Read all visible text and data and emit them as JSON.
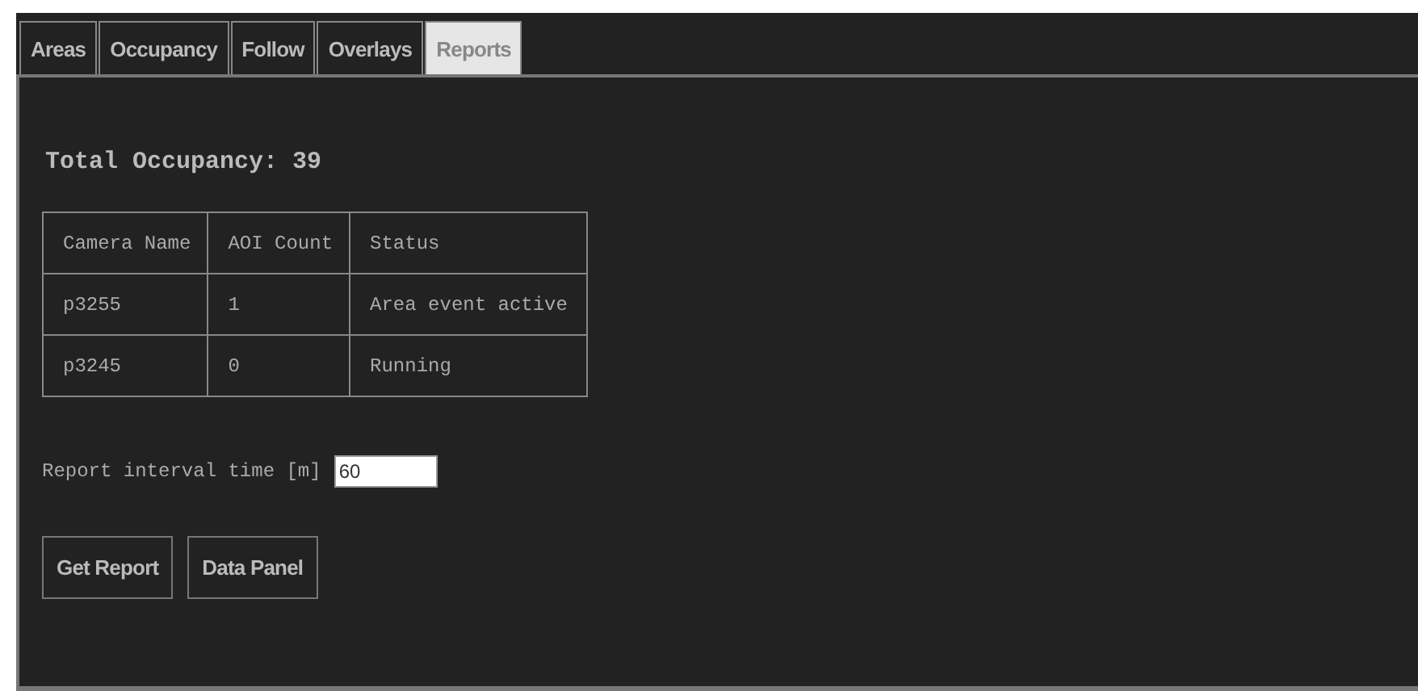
{
  "tabs": [
    {
      "label": "Areas",
      "selected": false
    },
    {
      "label": "Occupancy",
      "selected": false
    },
    {
      "label": "Follow",
      "selected": false
    },
    {
      "label": "Overlays",
      "selected": false
    },
    {
      "label": "Reports",
      "selected": true
    }
  ],
  "total_occupancy": "Total Occupancy: 39",
  "table": {
    "columns": [
      "Camera Name",
      "AOI Count",
      "Status"
    ],
    "rows": [
      [
        "p3255",
        "1",
        "Area event active"
      ],
      [
        "p3245",
        "0",
        "Running"
      ]
    ]
  },
  "report_interval": {
    "label": "Report interval time [m]",
    "value": "60"
  },
  "buttons": [
    "Get Report",
    "Data Panel"
  ]
}
